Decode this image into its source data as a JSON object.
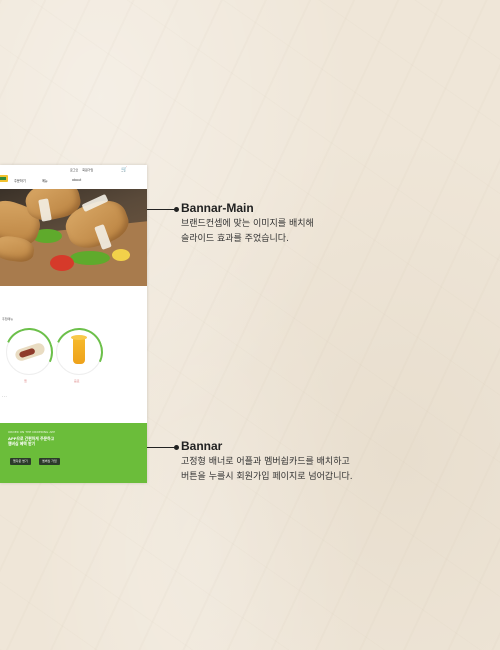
{
  "mockup": {
    "util_links": [
      "로그인",
      "회원가입"
    ],
    "cart_icon": "cart-icon",
    "menu": [
      "주문하기",
      "메뉴",
      "about"
    ],
    "menu_section_title": "추천메뉴",
    "items": [
      {
        "caption": "랩",
        "icon": "wrap-icon"
      },
      {
        "caption": "음료",
        "icon": "juice-icon"
      }
    ],
    "more_dots": "...",
    "banner_sub": "ORDER ON THE ORDERING APP",
    "banner_title_line1": "APP으로 간편하게 주문하고",
    "banner_title_line2": "멤버십 혜택 받기",
    "banner_buttons": [
      "앱다운 받기",
      "멤버십 가입"
    ],
    "colors": {
      "accent_green": "#6bbd3a",
      "logo_yellow": "#f2c230"
    }
  },
  "annotations": [
    {
      "title": "Bannar-Main",
      "line1": "브랜드컨셉에 맞는 이미지를 배치해",
      "line2": "슬라이드 효과를 주었습니다."
    },
    {
      "title": "Bannar",
      "line1": "고정형 배너로 어플과 멤버쉽카드를 배치하고",
      "line2": "버튼을 누를시 회원가입 페이지로 넘어갑니다."
    }
  ]
}
